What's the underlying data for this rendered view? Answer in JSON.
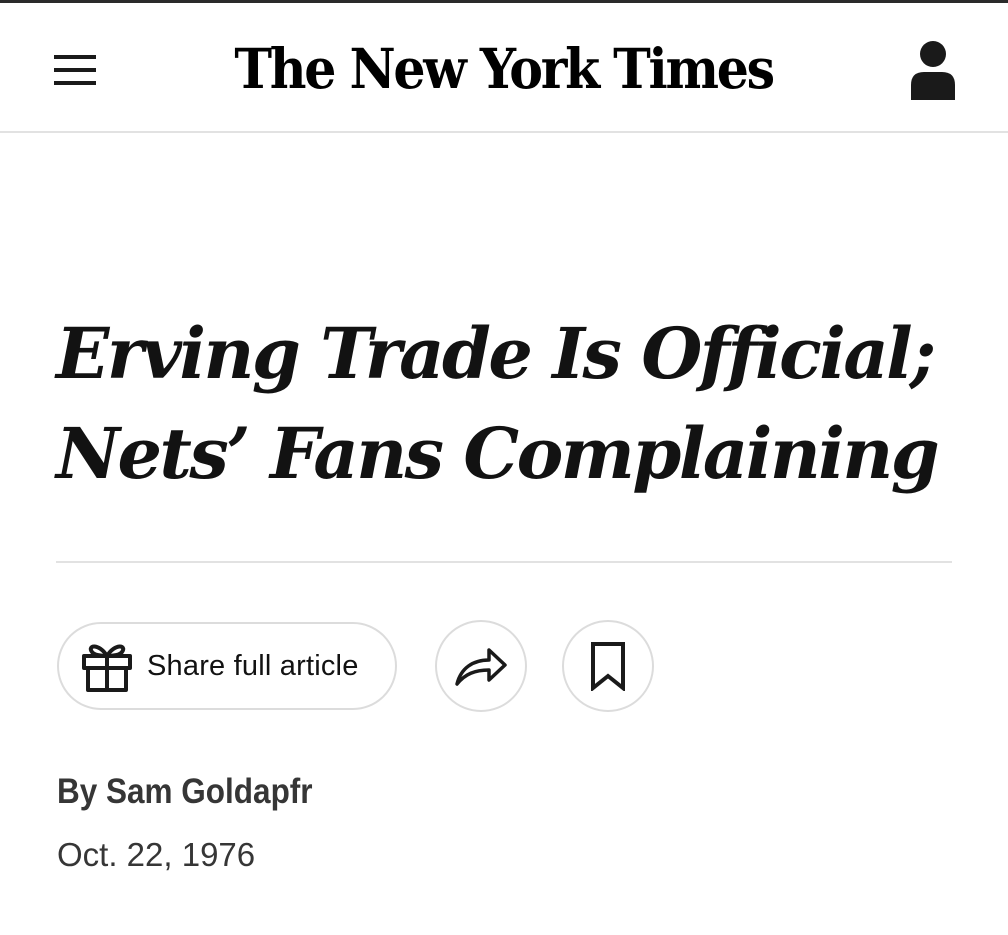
{
  "masthead": {
    "logo_text": "The New York Times",
    "menu_icon": "hamburger-menu-icon",
    "account_icon": "user-account-icon"
  },
  "article": {
    "headline_line1": "Erving Trade Is Official;",
    "headline_line2": "Nets’ Fans Complaining",
    "byline": "By Sam Goldapfr",
    "date": "Oct. 22, 1976"
  },
  "actions": {
    "share_label": "Share full article",
    "share_icon": "gift-icon",
    "forward_icon": "share-arrow-icon",
    "save_icon": "bookmark-icon"
  },
  "colors": {
    "text": "#121212",
    "meta_text": "#363636",
    "divider": "#e2e2e2",
    "button_border": "#dcdcdc"
  }
}
